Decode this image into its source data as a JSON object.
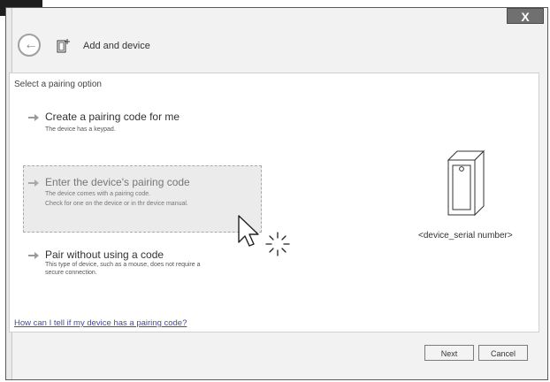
{
  "window": {
    "close_label": "X"
  },
  "header": {
    "title": "Add and device"
  },
  "content": {
    "section_title": "Select a pairing option",
    "options": [
      {
        "title": "Create a pairing code for me",
        "desc": [
          "The device has a keypad."
        ]
      },
      {
        "title": "Enter the device's pairing code",
        "desc": [
          "The device comes with a pairing code.",
          "Check for one on the device or in thr device manual."
        ]
      },
      {
        "title": "Pair without using a code",
        "desc": [
          "This type of device, such as a mouse, does not require a",
          "secure connection."
        ]
      }
    ],
    "device_label": "<device_serial number>",
    "help_link": "How can I tell if my device has a pairing code?"
  },
  "footer": {
    "next_label": "Next",
    "cancel_label": "Cancel"
  },
  "colors": {
    "link": "#4a4a9a",
    "selected_bg": "#ebebeb",
    "close_bg": "#707070"
  },
  "icons": [
    "back-arrow-icon",
    "device-icon",
    "arrow-right-icon",
    "device-tower-icon",
    "cursor-icon",
    "click-sparkle-icon"
  ]
}
